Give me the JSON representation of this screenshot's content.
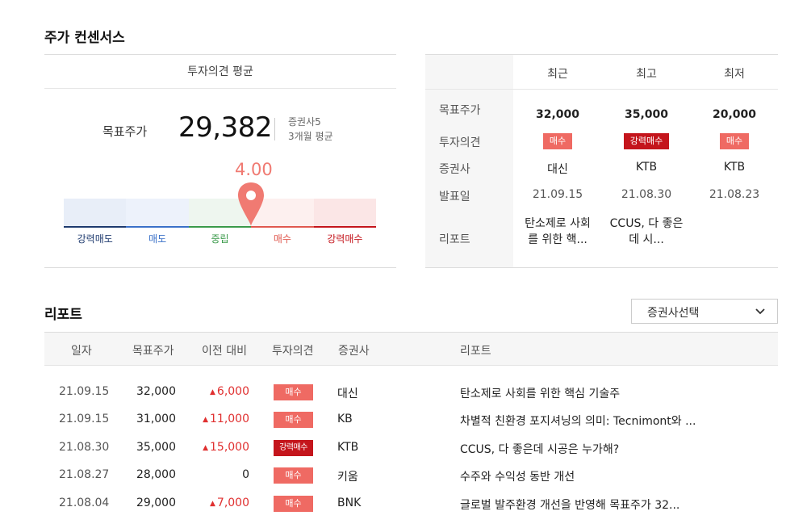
{
  "consensus": {
    "section_title": "주가 컨센서스",
    "panel_header": "투자의견 평균",
    "target_label": "목표주가",
    "target_value": "29,382",
    "brokers": "증권사5",
    "period": "3개월 평균",
    "score": "4.00",
    "score_fraction": 0.6,
    "gauge": [
      {
        "label": "강력매도",
        "color": "#1e3a6e",
        "fill": "#e8eef8"
      },
      {
        "label": "매도",
        "color": "#3a70c8",
        "fill": "#edf2fb"
      },
      {
        "label": "중립",
        "color": "#3a9a4a",
        "fill": "#eef6ef"
      },
      {
        "label": "매수",
        "color": "#e0594f",
        "fill": "#fdf0ef"
      },
      {
        "label": "강력매수",
        "color": "#c4151c",
        "fill": "#fbe6e6"
      }
    ],
    "pin_color": "#f07a72"
  },
  "recent": {
    "columns": [
      "최근",
      "최고",
      "최저"
    ],
    "row_labels": [
      "목표주가",
      "투자의견",
      "증권사",
      "발표일",
      "리포트"
    ],
    "items": [
      {
        "target": "32,000",
        "opinion": "매수",
        "strong": false,
        "broker": "대신",
        "date": "21.09.15",
        "report_l1": "탄소제로 사회",
        "report_l2": "를 위한 핵..."
      },
      {
        "target": "35,000",
        "opinion": "강력매수",
        "strong": true,
        "broker": "KTB",
        "date": "21.08.30",
        "report_l1": "CCUS, 다 좋은",
        "report_l2": "데 시..."
      },
      {
        "target": "20,000",
        "opinion": "매수",
        "strong": false,
        "broker": "KTB",
        "date": "21.08.23",
        "report_l1": "",
        "report_l2": ""
      }
    ]
  },
  "reports": {
    "section_title": "리포트",
    "dropdown_label": "증권사선택",
    "headers": {
      "date": "일자",
      "target": "목표주가",
      "change": "이전 대비",
      "opinion": "투자의견",
      "broker": "증권사",
      "report": "리포트"
    },
    "rows": [
      {
        "date": "21.09.15",
        "target": "32,000",
        "change": "6,000",
        "up": true,
        "opinion": "매수",
        "strong": false,
        "broker": "대신",
        "title": "탄소제로 사회를 위한 핵심 기술주"
      },
      {
        "date": "21.09.15",
        "target": "31,000",
        "change": "11,000",
        "up": true,
        "opinion": "매수",
        "strong": false,
        "broker": "KB",
        "title": "차별적 친환경 포지셔닝의 의미: Tecnimont와 ..."
      },
      {
        "date": "21.08.30",
        "target": "35,000",
        "change": "15,000",
        "up": true,
        "opinion": "강력매수",
        "strong": true,
        "broker": "KTB",
        "title": "CCUS, 다 좋은데 시공은 누가해?"
      },
      {
        "date": "21.08.27",
        "target": "28,000",
        "change": "0",
        "up": false,
        "opinion": "매수",
        "strong": false,
        "broker": "키움",
        "title": "수주와 수익성 동반 개선"
      },
      {
        "date": "21.08.04",
        "target": "29,000",
        "change": "7,000",
        "up": true,
        "opinion": "매수",
        "strong": false,
        "broker": "BNK",
        "title": "글로벌 발주환경 개선을 반영해 목표주가 32..."
      }
    ],
    "up_icon": "triangle-up-icon"
  }
}
